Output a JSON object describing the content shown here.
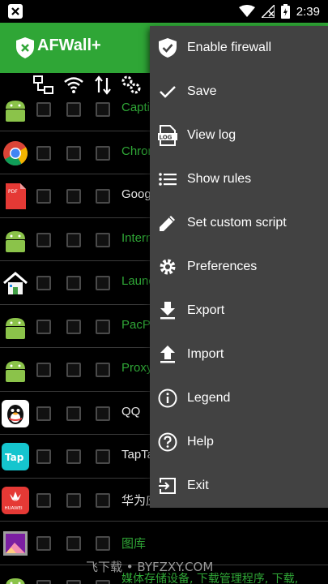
{
  "status_bar": {
    "time": "2:39"
  },
  "app_bar": {
    "title": "AFWall+"
  },
  "columns": [
    "lan-icon",
    "wifi-icon",
    "mobile-data-icon",
    "settings-icon"
  ],
  "apps": [
    {
      "name": "Captive",
      "icon": "android-icon",
      "kind": "sys"
    },
    {
      "name": "Chrome",
      "icon": "chrome-icon",
      "kind": "sys"
    },
    {
      "name": "Google",
      "icon": "pdf-icon",
      "kind": "user"
    },
    {
      "name": "Internet",
      "icon": "android-icon",
      "kind": "sys"
    },
    {
      "name": "Launcher",
      "icon": "home-icon",
      "kind": "sys"
    },
    {
      "name": "PacP",
      "icon": "android-icon",
      "kind": "sys"
    },
    {
      "name": "Proxy",
      "icon": "android-icon",
      "kind": "sys"
    },
    {
      "name": "QQ",
      "icon": "qq-icon",
      "kind": "user"
    },
    {
      "name": "TapTap",
      "icon": "taptap-icon",
      "kind": "user"
    },
    {
      "name": "华为应用",
      "icon": "huawei-icon",
      "kind": "user"
    },
    {
      "name": "图库",
      "icon": "gallery-icon",
      "kind": "sys"
    }
  ],
  "menu": {
    "items": [
      {
        "label": "Enable firewall",
        "icon": "shield-check-icon"
      },
      {
        "label": "Save",
        "icon": "check-icon"
      },
      {
        "label": "View log",
        "icon": "log-icon"
      },
      {
        "label": "Show rules",
        "icon": "list-icon"
      },
      {
        "label": "Set custom script",
        "icon": "pencil-icon"
      },
      {
        "label": "Preferences",
        "icon": "gear-icon"
      },
      {
        "label": "Export",
        "icon": "download-icon"
      },
      {
        "label": "Import",
        "icon": "upload-icon"
      },
      {
        "label": "Legend",
        "icon": "info-icon"
      },
      {
        "label": "Help",
        "icon": "help-icon"
      },
      {
        "label": "Exit",
        "icon": "exit-icon"
      }
    ]
  },
  "watermark": {
    "site": "飞下载 • BYFZXY.COM",
    "text": "媒体存储设备, 下载管理程序, 下载,"
  },
  "colors": {
    "accent": "#2fa636",
    "menu_bg": "#424242",
    "background": "#000000"
  }
}
